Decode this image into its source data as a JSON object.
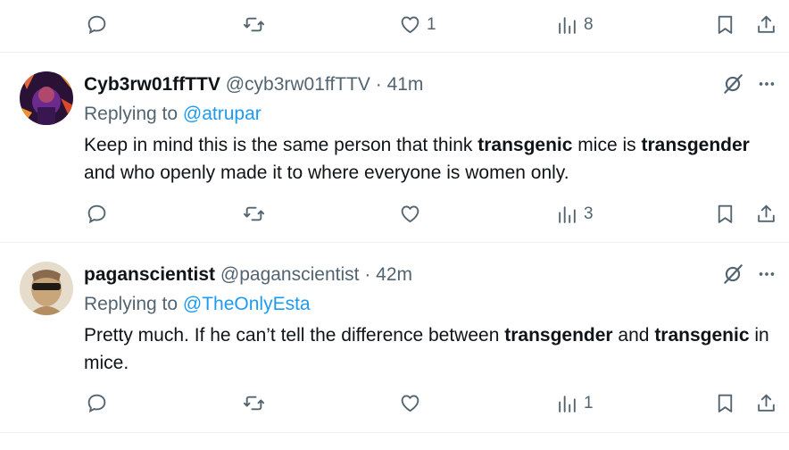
{
  "top_actions": {
    "reply_count": "",
    "repost_count": "",
    "like_count": "1",
    "views_count": "8"
  },
  "posts": [
    {
      "display_name": "Cyb3rw01ffTTV",
      "handle": "@cyb3rw01ffTTV",
      "separator": "·",
      "time": "41m",
      "replying_prefix": "Replying to",
      "replying_to": "@atrupar",
      "body_segments": [
        "Keep in mind this is the same person that think ",
        "transgenic",
        " mice is ",
        "transgender",
        " and who openly made it to where everyone is women only."
      ],
      "reply_count": "",
      "repost_count": "",
      "like_count": "",
      "views_count": "3"
    },
    {
      "display_name": "paganscientist",
      "handle": "@paganscientist",
      "separator": "·",
      "time": "42m",
      "replying_prefix": "Replying to",
      "replying_to": "@TheOnlyEsta",
      "body_segments": [
        "Pretty much. If he can’t tell the difference between ",
        "transgender",
        " and ",
        "transgenic",
        " in mice."
      ],
      "reply_count": "",
      "repost_count": "",
      "like_count": "",
      "views_count": "1"
    }
  ],
  "icons": {
    "reply": "speech-bubble-icon",
    "repost": "repost-arrows-icon",
    "like": "heart-icon",
    "views": "bar-chart-icon",
    "bookmark": "bookmark-icon",
    "share": "share-upload-icon",
    "grok": "grok-slash-icon",
    "more": "more-dots-icon"
  },
  "colors": {
    "text": "#0f1419",
    "secondary": "#536471",
    "link": "#1d9bf0",
    "divider": "#eff3f4"
  }
}
